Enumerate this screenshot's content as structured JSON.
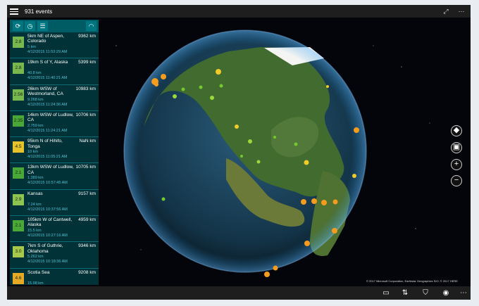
{
  "app": {
    "title": "931 events"
  },
  "toolbar": {
    "tools": [
      "refresh",
      "history",
      "list-view",
      "signal"
    ]
  },
  "events": [
    {
      "magnitude": "2.8",
      "place": "5km NE of Aspen, Colorado",
      "distance": "9362 km",
      "depth": "5 km",
      "time": "4/12/2015 11:53:29 AM",
      "color": "#78b84e"
    },
    {
      "magnitude": "2.8",
      "place": "19km S of Y, Alaska",
      "distance": "5399 km",
      "depth": "40.8 km",
      "time": "4/12/2015 11:40:21 AM",
      "color": "#78b84e"
    },
    {
      "magnitude": "2.56",
      "place": "26km WSW of Westmorland, CA",
      "distance": "10983 km",
      "depth": "9.268 km",
      "time": "4/12/2015 11:24:36 AM",
      "color": "#78b84e"
    },
    {
      "magnitude": "2.35",
      "place": "14km WSW of Ludlow, CA",
      "distance": "10706 km",
      "depth": "2.759 km",
      "time": "4/12/2015 11:24:21 AM",
      "color": "#4aa838"
    },
    {
      "magnitude": "4.5",
      "place": "95km N of Hihifo, Tonga",
      "distance": "NaN km",
      "depth": "10 km",
      "time": "4/12/2015 11:05:21 AM",
      "color": "#e6c22b"
    },
    {
      "magnitude": "2.1",
      "place": "13km WSW of Ludlow, CA",
      "distance": "10705 km",
      "depth": "1.389 km",
      "time": "4/12/2015 10:57:45 AM",
      "color": "#4aa838"
    },
    {
      "magnitude": "2.9",
      "place": "Kansas",
      "distance": "9157 km",
      "depth": "7.24 km",
      "time": "4/12/2015 10:37:56 AM",
      "color": "#8ec550"
    },
    {
      "magnitude": "2.1",
      "place": "105km W of Cantwell, Alaska",
      "distance": "4959 km",
      "depth": "15.5 km",
      "time": "4/12/2015 10:27:16 AM",
      "color": "#4aa838"
    },
    {
      "magnitude": "3.0",
      "place": "7km S of Guthrie, Oklahoma",
      "distance": "9346 km",
      "depth": "5.262 km",
      "time": "4/12/2015 10:18:36 AM",
      "color": "#a7c84b"
    },
    {
      "magnitude": "4.6",
      "place": "Scotia Sea",
      "distance": "9208 km",
      "depth": "15.98 km",
      "time": "",
      "color": "#e6aa24"
    }
  ],
  "map_controls": {
    "compass": "compass",
    "tilt": "tilt",
    "zoom_in": "+",
    "zoom_out": "−"
  },
  "copyright": "© 2017 Microsoft Corporation, Earthstar Geographics  SIO, © 2017 HERE",
  "bottom": {
    "icons": [
      "map-view",
      "sort",
      "filter",
      "location",
      "more"
    ]
  }
}
